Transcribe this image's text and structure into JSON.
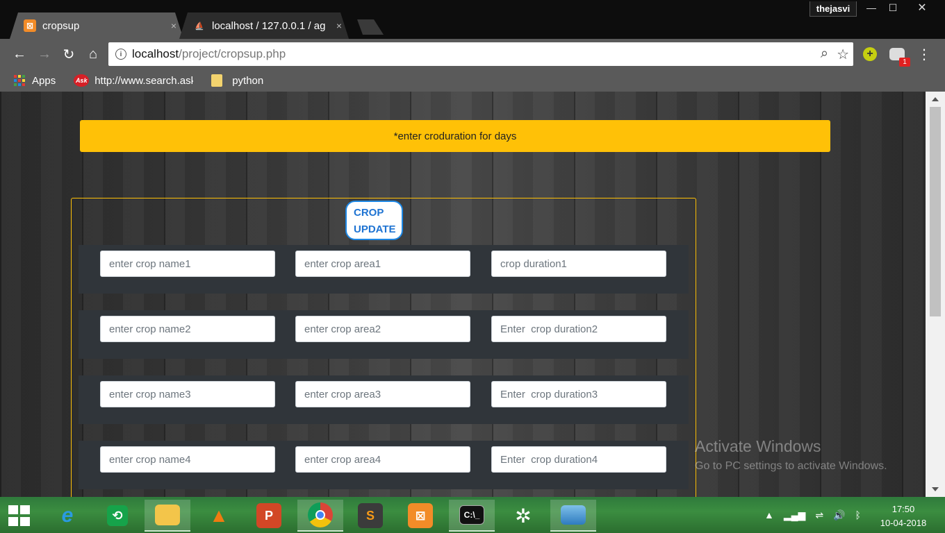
{
  "window": {
    "profile_name": "thejasvi",
    "min_glyph": "—",
    "max_glyph": "☐",
    "close_glyph": "✕"
  },
  "tabs": [
    {
      "title": "cropsup",
      "favicon": "xampp-icon",
      "close": "×",
      "active": true
    },
    {
      "title": "localhost / 127.0.0.1 / ag",
      "favicon": "phpmyadmin-icon",
      "close": "×",
      "active": false
    }
  ],
  "toolbar": {
    "url_host": "localhost",
    "url_path": "/project/cropsup.php"
  },
  "bookmarks": [
    {
      "label": "Apps",
      "icon": "apps-grid-icon"
    },
    {
      "label": "http://www.search.ask.com",
      "icon": "ask-icon"
    },
    {
      "label": "python",
      "icon": "folder-icon"
    }
  ],
  "page": {
    "alert_text": "*enter croduration for days",
    "form_title_line1": "CROP",
    "form_title_line2": "UPDATE",
    "rows": [
      {
        "name_ph": "enter crop name1",
        "area_ph": "enter crop area1",
        "duration_ph": "crop duration1"
      },
      {
        "name_ph": "enter crop name2",
        "area_ph": "enter crop area2",
        "duration_ph": "Enter  crop duration2"
      },
      {
        "name_ph": "enter crop name3",
        "area_ph": "enter crop area3",
        "duration_ph": "Enter  crop duration3"
      },
      {
        "name_ph": "enter crop name4",
        "area_ph": "enter crop area4",
        "duration_ph": "Enter  crop duration4"
      }
    ]
  },
  "watermark": {
    "line1": "Activate Windows",
    "line2": "Go to PC settings to activate Windows."
  },
  "taskbar": {
    "apps": [
      "internet-explorer-icon",
      "green-app-icon",
      "file-explorer-icon",
      "vlc-icon",
      "powerpoint-icon",
      "chrome-icon",
      "sublime-text-icon",
      "xampp-icon",
      "command-prompt-icon",
      "spider-app-icon",
      "photos-icon"
    ],
    "time": "17:50",
    "date": "10-04-2018"
  },
  "colors": {
    "alert": "#ffc107",
    "form_border": "#ffc107",
    "title_blue": "#1e73d2",
    "row_bg": "#30353a",
    "taskbar_green": "#3b8d40"
  }
}
